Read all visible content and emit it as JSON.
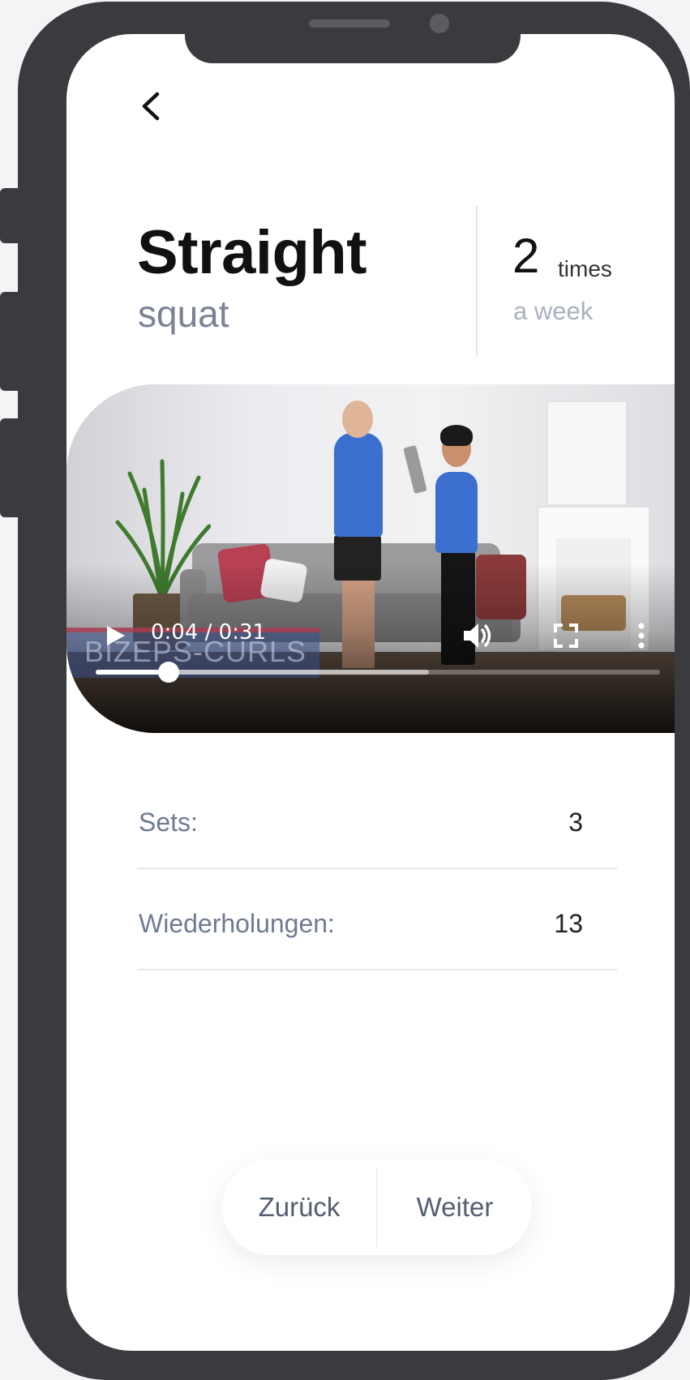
{
  "header": {
    "title": "Straight",
    "subtitle": "squat",
    "frequency_count": "2",
    "frequency_unit": "times",
    "frequency_period": "a week"
  },
  "video": {
    "time_display": "0:04 / 0:31",
    "caption_overlay": "BIZEPS-CURLS",
    "played_fraction": 0.13,
    "buffered_fraction": 0.59
  },
  "stats": [
    {
      "label": "Sets:",
      "value": "3"
    },
    {
      "label": "Wiederholungen:",
      "value": "13"
    }
  ],
  "navigation": {
    "back_label": "Zurück",
    "next_label": "Weiter"
  },
  "icons": {
    "back": "chevron-left-icon",
    "play": "play-icon",
    "volume": "volume-icon",
    "fullscreen": "fullscreen-icon",
    "more": "more-vertical-icon"
  },
  "colors": {
    "title": "#111111",
    "subtitle": "#7a8294",
    "muted": "#aab0bf",
    "label": "#6f7a93",
    "frame": "#3a3a3f"
  }
}
